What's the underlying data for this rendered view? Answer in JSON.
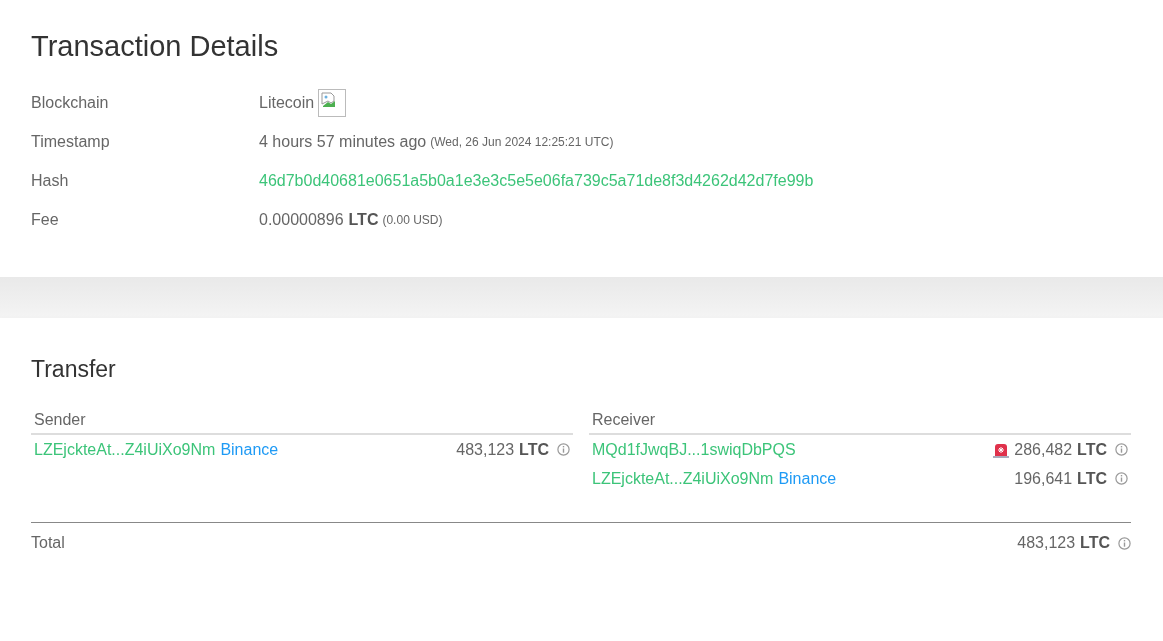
{
  "details": {
    "title": "Transaction Details",
    "rows": [
      {
        "kind": "image",
        "label": "Blockchain",
        "value": "Litecoin"
      },
      {
        "kind": "time",
        "label": "Timestamp",
        "value": "4 hours 57 minutes ago",
        "note": "(Wed, 26 Jun 2024 12:25:21 UTC)"
      },
      {
        "kind": "hash",
        "label": "Hash",
        "value": "46d7b0d40681e0651a5b0a1e3e3c5e5e06fa739c5a71de8f3d4262d42d7fe99b"
      },
      {
        "kind": "amount",
        "label": "Fee",
        "value": "0.00000896",
        "unit": "LTC",
        "note": "(0.00 USD)"
      }
    ]
  },
  "transfer": {
    "title": "Transfer",
    "sender": {
      "heading": "Sender",
      "entries": [
        {
          "address": "LZEjckteAt...Z4iUiXo9Nm",
          "tag": "Binance",
          "alert": false,
          "amount": "483,123",
          "unit": "LTC"
        }
      ]
    },
    "receiver": {
      "heading": "Receiver",
      "entries": [
        {
          "address": "MQd1fJwqBJ...1swiqDbPQS",
          "alert": true,
          "amount": "286,482",
          "unit": "LTC"
        },
        {
          "address": "LZEjckteAt...Z4iUiXo9Nm",
          "tag": "Binance",
          "alert": false,
          "amount": "196,641",
          "unit": "LTC"
        }
      ]
    },
    "total": {
      "label": "Total",
      "amount": "483,123",
      "unit": "LTC"
    }
  }
}
